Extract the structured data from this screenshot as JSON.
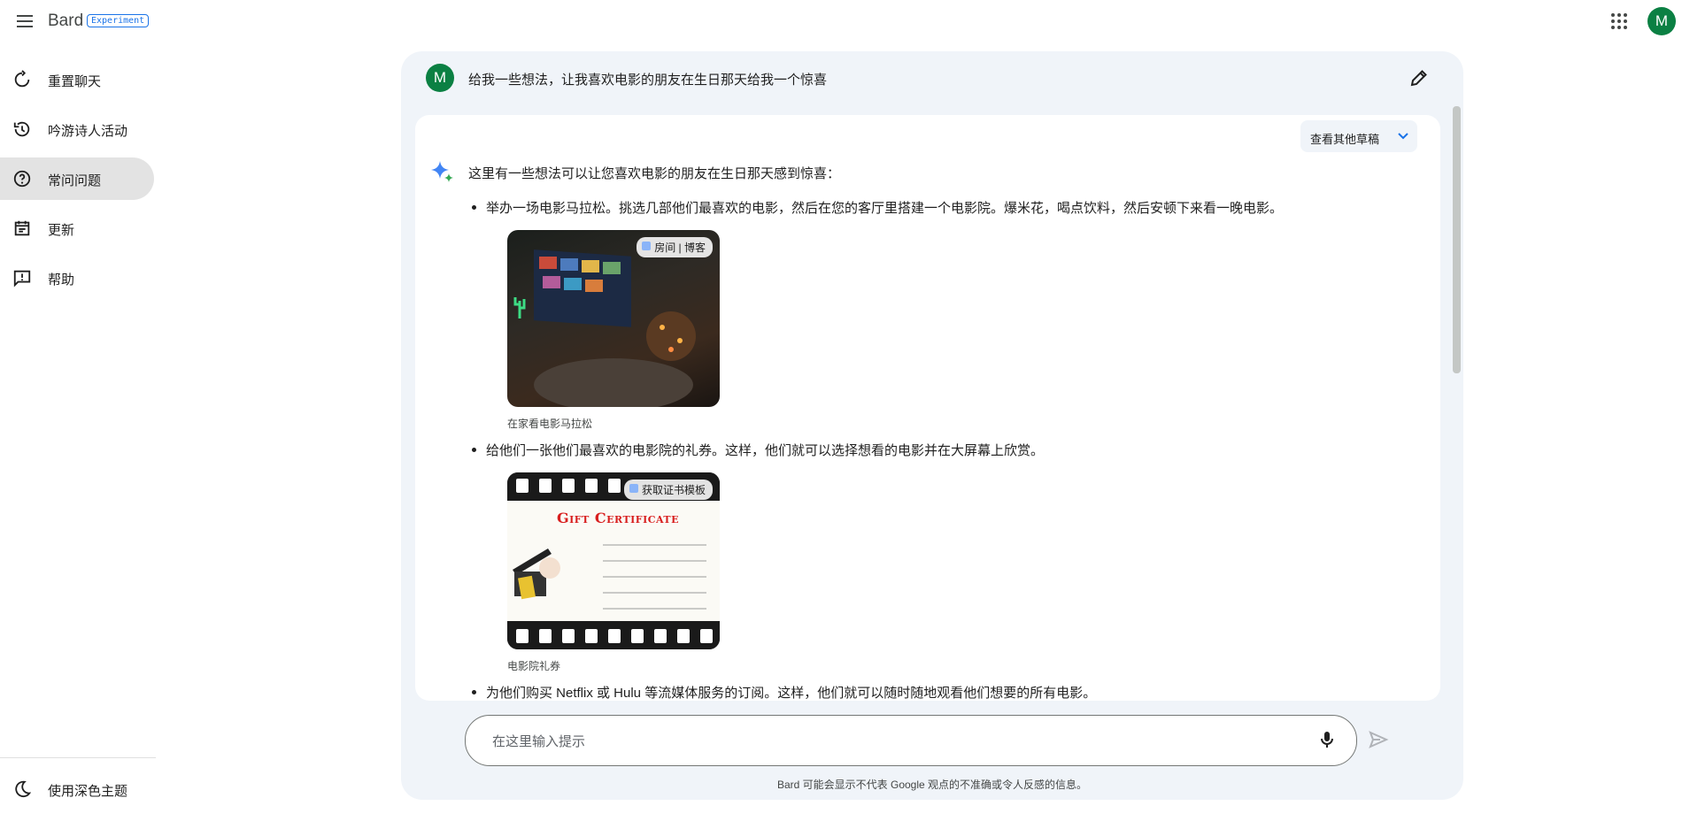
{
  "app": {
    "brand": "Bard",
    "badge": "Experiment",
    "avatar_initial": "M"
  },
  "sidebar": {
    "items": [
      {
        "label": "重置聊天",
        "icon": "reset-icon"
      },
      {
        "label": "吟游诗人活动",
        "icon": "history-icon"
      },
      {
        "label": "常问问题",
        "icon": "help-circle-icon",
        "active": true
      },
      {
        "label": "更新",
        "icon": "calendar-icon"
      },
      {
        "label": "帮助",
        "icon": "feedback-icon"
      }
    ],
    "dark_theme_label": "使用深色主题"
  },
  "conversation": {
    "user_initial": "M",
    "user_prompt": "给我一些想法，让我喜欢电影的朋友在生日那天给我一个惊喜",
    "drafts_label": "查看其他草稿",
    "intro": "这里有一些想法可以让您喜欢电影的朋友在生日那天感到惊喜：",
    "bullets": [
      "举办一场电影马拉松。挑选几部他们最喜欢的电影，然后在您的客厅里搭建一个电影院。爆米花，喝点饮料，然后安顿下来看一晚电影。",
      "给他们一张他们最喜欢的电影院的礼券。这样，他们就可以选择想看的电影并在大屏幕上欣赏。",
      "为他们购买 Netflix 或 Hulu 等流媒体服务的订阅。这样，他们就可以随时随地观看他们想要的所有电影。"
    ],
    "images": [
      {
        "source": "房间 | 博客",
        "caption": "在家看电影马拉松"
      },
      {
        "source": "获取证书模板",
        "caption": "电影院礼券",
        "certificate_title": "Gift Certificate"
      }
    ]
  },
  "input": {
    "placeholder": "在这里输入提示"
  },
  "disclaimer": "Bard 可能会显示不代表 Google 观点的不准确或令人反感的信息。",
  "colors": {
    "panel_bg": "#f0f4f9",
    "avatar": "#0b8043",
    "accent": "#1a73e8",
    "active_item": "#e3e3e3"
  }
}
